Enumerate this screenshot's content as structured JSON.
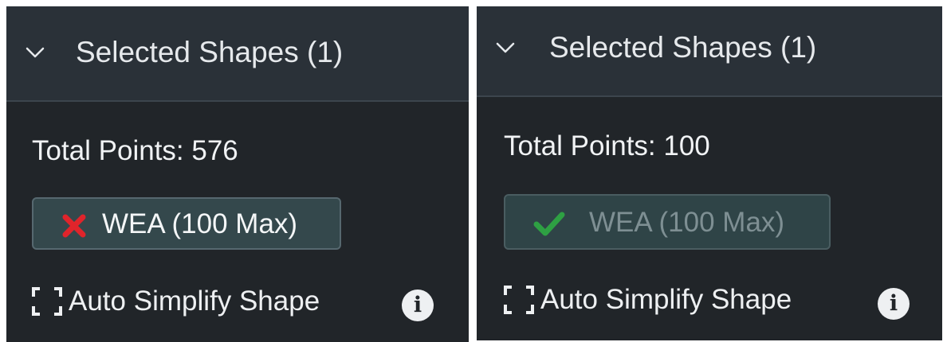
{
  "colors": {
    "panel_bg": "#212529",
    "header_bg": "#2a3138",
    "badge_bg": "#34484c",
    "error_red": "#e0242b",
    "success_green": "#2ea043",
    "disabled_text": "#7e8f93"
  },
  "panels": [
    {
      "header": {
        "chevron_icon": "chevron-down-icon",
        "title": "Selected Shapes (1)"
      },
      "total_points": "Total Points: 576",
      "wea_badge": {
        "status_icon": "x-mark-icon",
        "label": "WEA (100 Max)",
        "state": "invalid"
      },
      "auto_simplify": {
        "icon": "frame-corners-icon",
        "label": "Auto Simplify Shape"
      },
      "info_icon": {
        "name": "info-icon",
        "glyph": "i"
      }
    },
    {
      "header": {
        "chevron_icon": "chevron-down-icon",
        "title": "Selected Shapes (1)"
      },
      "total_points": "Total Points: 100",
      "wea_badge": {
        "status_icon": "checkmark-icon",
        "label": "WEA (100 Max)",
        "state": "valid"
      },
      "auto_simplify": {
        "icon": "frame-corners-icon",
        "label": "Auto Simplify Shape"
      },
      "info_icon": {
        "name": "info-icon",
        "glyph": "i"
      }
    }
  ]
}
